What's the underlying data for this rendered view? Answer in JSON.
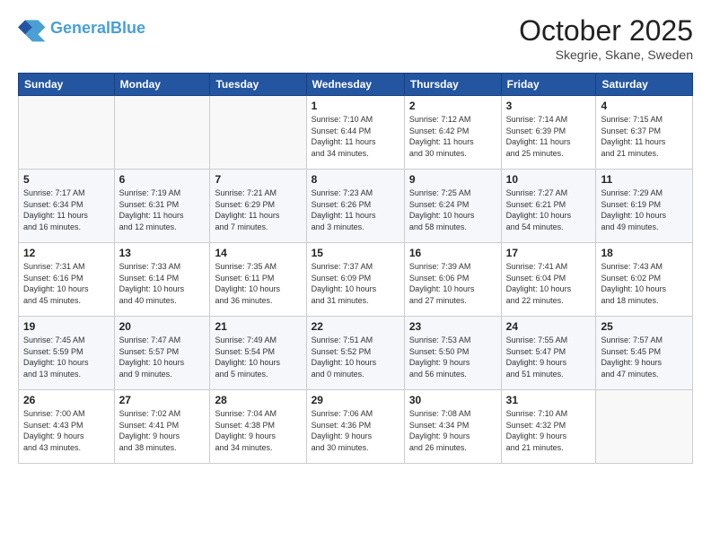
{
  "header": {
    "logo_line1": "General",
    "logo_line2": "Blue",
    "title": "October 2025",
    "location": "Skegrie, Skane, Sweden"
  },
  "weekdays": [
    "Sunday",
    "Monday",
    "Tuesday",
    "Wednesday",
    "Thursday",
    "Friday",
    "Saturday"
  ],
  "weeks": [
    [
      {
        "day": "",
        "info": ""
      },
      {
        "day": "",
        "info": ""
      },
      {
        "day": "",
        "info": ""
      },
      {
        "day": "1",
        "info": "Sunrise: 7:10 AM\nSunset: 6:44 PM\nDaylight: 11 hours\nand 34 minutes."
      },
      {
        "day": "2",
        "info": "Sunrise: 7:12 AM\nSunset: 6:42 PM\nDaylight: 11 hours\nand 30 minutes."
      },
      {
        "day": "3",
        "info": "Sunrise: 7:14 AM\nSunset: 6:39 PM\nDaylight: 11 hours\nand 25 minutes."
      },
      {
        "day": "4",
        "info": "Sunrise: 7:15 AM\nSunset: 6:37 PM\nDaylight: 11 hours\nand 21 minutes."
      }
    ],
    [
      {
        "day": "5",
        "info": "Sunrise: 7:17 AM\nSunset: 6:34 PM\nDaylight: 11 hours\nand 16 minutes."
      },
      {
        "day": "6",
        "info": "Sunrise: 7:19 AM\nSunset: 6:31 PM\nDaylight: 11 hours\nand 12 minutes."
      },
      {
        "day": "7",
        "info": "Sunrise: 7:21 AM\nSunset: 6:29 PM\nDaylight: 11 hours\nand 7 minutes."
      },
      {
        "day": "8",
        "info": "Sunrise: 7:23 AM\nSunset: 6:26 PM\nDaylight: 11 hours\nand 3 minutes."
      },
      {
        "day": "9",
        "info": "Sunrise: 7:25 AM\nSunset: 6:24 PM\nDaylight: 10 hours\nand 58 minutes."
      },
      {
        "day": "10",
        "info": "Sunrise: 7:27 AM\nSunset: 6:21 PM\nDaylight: 10 hours\nand 54 minutes."
      },
      {
        "day": "11",
        "info": "Sunrise: 7:29 AM\nSunset: 6:19 PM\nDaylight: 10 hours\nand 49 minutes."
      }
    ],
    [
      {
        "day": "12",
        "info": "Sunrise: 7:31 AM\nSunset: 6:16 PM\nDaylight: 10 hours\nand 45 minutes."
      },
      {
        "day": "13",
        "info": "Sunrise: 7:33 AM\nSunset: 6:14 PM\nDaylight: 10 hours\nand 40 minutes."
      },
      {
        "day": "14",
        "info": "Sunrise: 7:35 AM\nSunset: 6:11 PM\nDaylight: 10 hours\nand 36 minutes."
      },
      {
        "day": "15",
        "info": "Sunrise: 7:37 AM\nSunset: 6:09 PM\nDaylight: 10 hours\nand 31 minutes."
      },
      {
        "day": "16",
        "info": "Sunrise: 7:39 AM\nSunset: 6:06 PM\nDaylight: 10 hours\nand 27 minutes."
      },
      {
        "day": "17",
        "info": "Sunrise: 7:41 AM\nSunset: 6:04 PM\nDaylight: 10 hours\nand 22 minutes."
      },
      {
        "day": "18",
        "info": "Sunrise: 7:43 AM\nSunset: 6:02 PM\nDaylight: 10 hours\nand 18 minutes."
      }
    ],
    [
      {
        "day": "19",
        "info": "Sunrise: 7:45 AM\nSunset: 5:59 PM\nDaylight: 10 hours\nand 13 minutes."
      },
      {
        "day": "20",
        "info": "Sunrise: 7:47 AM\nSunset: 5:57 PM\nDaylight: 10 hours\nand 9 minutes."
      },
      {
        "day": "21",
        "info": "Sunrise: 7:49 AM\nSunset: 5:54 PM\nDaylight: 10 hours\nand 5 minutes."
      },
      {
        "day": "22",
        "info": "Sunrise: 7:51 AM\nSunset: 5:52 PM\nDaylight: 10 hours\nand 0 minutes."
      },
      {
        "day": "23",
        "info": "Sunrise: 7:53 AM\nSunset: 5:50 PM\nDaylight: 9 hours\nand 56 minutes."
      },
      {
        "day": "24",
        "info": "Sunrise: 7:55 AM\nSunset: 5:47 PM\nDaylight: 9 hours\nand 51 minutes."
      },
      {
        "day": "25",
        "info": "Sunrise: 7:57 AM\nSunset: 5:45 PM\nDaylight: 9 hours\nand 47 minutes."
      }
    ],
    [
      {
        "day": "26",
        "info": "Sunrise: 7:00 AM\nSunset: 4:43 PM\nDaylight: 9 hours\nand 43 minutes."
      },
      {
        "day": "27",
        "info": "Sunrise: 7:02 AM\nSunset: 4:41 PM\nDaylight: 9 hours\nand 38 minutes."
      },
      {
        "day": "28",
        "info": "Sunrise: 7:04 AM\nSunset: 4:38 PM\nDaylight: 9 hours\nand 34 minutes."
      },
      {
        "day": "29",
        "info": "Sunrise: 7:06 AM\nSunset: 4:36 PM\nDaylight: 9 hours\nand 30 minutes."
      },
      {
        "day": "30",
        "info": "Sunrise: 7:08 AM\nSunset: 4:34 PM\nDaylight: 9 hours\nand 26 minutes."
      },
      {
        "day": "31",
        "info": "Sunrise: 7:10 AM\nSunset: 4:32 PM\nDaylight: 9 hours\nand 21 minutes."
      },
      {
        "day": "",
        "info": ""
      }
    ]
  ]
}
